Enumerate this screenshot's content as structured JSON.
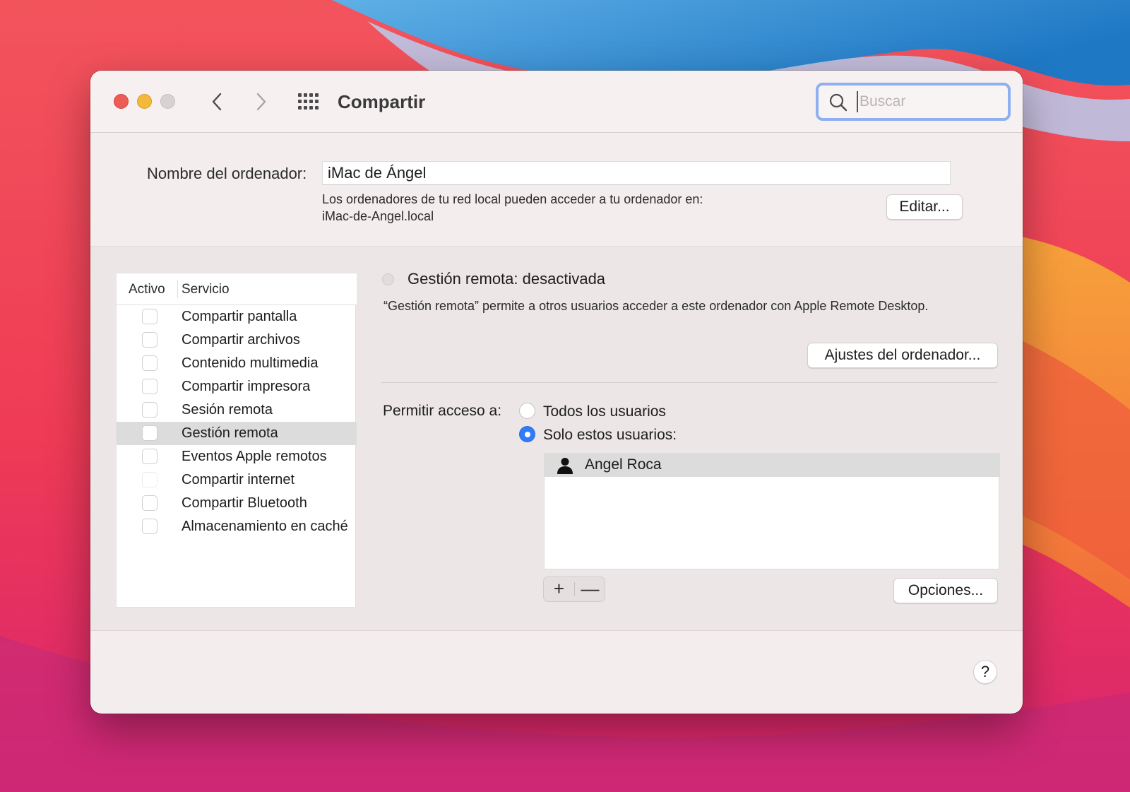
{
  "window": {
    "title": "Compartir",
    "search_placeholder": "Buscar"
  },
  "computer_name": {
    "label": "Nombre del ordenador:",
    "value": "iMac de Ángel",
    "info_line1": "Los ordenadores de tu red local pueden acceder a tu ordenador en:",
    "info_line2": "iMac-de-Angel.local",
    "edit_label": "Editar..."
  },
  "services": {
    "header_active": "Activo",
    "header_service": "Servicio",
    "items": [
      {
        "label": "Compartir pantalla",
        "checked": false,
        "selected": false
      },
      {
        "label": "Compartir archivos",
        "checked": false,
        "selected": false
      },
      {
        "label": "Contenido multimedia",
        "checked": false,
        "selected": false
      },
      {
        "label": "Compartir impresora",
        "checked": false,
        "selected": false
      },
      {
        "label": "Sesión remota",
        "checked": false,
        "selected": false
      },
      {
        "label": "Gestión remota",
        "checked": false,
        "selected": true
      },
      {
        "label": "Eventos Apple remotos",
        "checked": false,
        "selected": false
      },
      {
        "label": "Compartir internet",
        "checked": false,
        "selected": false,
        "disabled": true
      },
      {
        "label": "Compartir Bluetooth",
        "checked": false,
        "selected": false
      },
      {
        "label": "Almacenamiento en caché",
        "checked": false,
        "selected": false
      }
    ]
  },
  "detail": {
    "status_title": "Gestión remota: desactivada",
    "status_description": "“Gestión remota” permite a otros usuarios acceder a este ordenador con Apple Remote Desktop.",
    "settings_button": "Ajustes del ordenador...",
    "access_label": "Permitir acceso a:",
    "option_all": "Todos los usuarios",
    "option_only": "Solo estos usuarios:",
    "selected_option": "only",
    "users": [
      "Angel Roca"
    ],
    "add_label": "+",
    "remove_label": "—",
    "options_button": "Opciones..."
  },
  "help_label": "?",
  "colors": {
    "accent": "#2f7cf6",
    "close": "#ec5d58",
    "minimize": "#f3b93a",
    "window_bg": "#f4eded",
    "panel_bg": "#ede6e6"
  }
}
